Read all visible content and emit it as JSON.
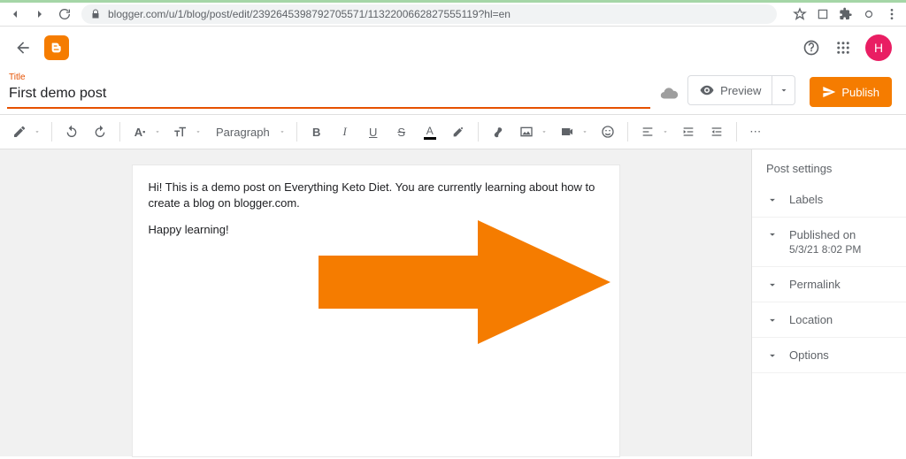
{
  "browser": {
    "url": "blogger.com/u/1/blog/post/edit/2392645398792705571/1132200662827555119?hl=en"
  },
  "header": {
    "avatar_letter": "H"
  },
  "title_area": {
    "label": "Title",
    "value": "First demo post"
  },
  "actions": {
    "preview": "Preview",
    "publish": "Publish"
  },
  "toolbar": {
    "paragraph": "Paragraph",
    "bold": "B",
    "italic": "I",
    "underline": "U",
    "strike": "S",
    "textcolor": "A",
    "more": "⋯"
  },
  "editor": {
    "p1": "Hi! This is a demo post on Everything Keto Diet. You are currently learning about how to create a blog on blogger.com.",
    "p2": "Happy learning!"
  },
  "settings": {
    "heading": "Post settings",
    "labels": "Labels",
    "published_label": "Published on",
    "published_value": "5/3/21 8:02 PM",
    "permalink": "Permalink",
    "location": "Location",
    "options": "Options"
  }
}
